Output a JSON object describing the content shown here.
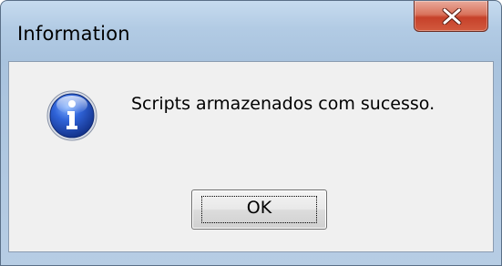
{
  "window": {
    "title": "Information"
  },
  "dialog": {
    "message": "Scripts armazenados com sucesso.",
    "icon": "information-icon",
    "ok_label": "OK"
  },
  "close_button": {
    "icon": "close-icon"
  },
  "colors": {
    "close_accent": "#c6412a",
    "info_icon_blue": "#1e4fb5",
    "client_background": "#f0f0f0"
  }
}
